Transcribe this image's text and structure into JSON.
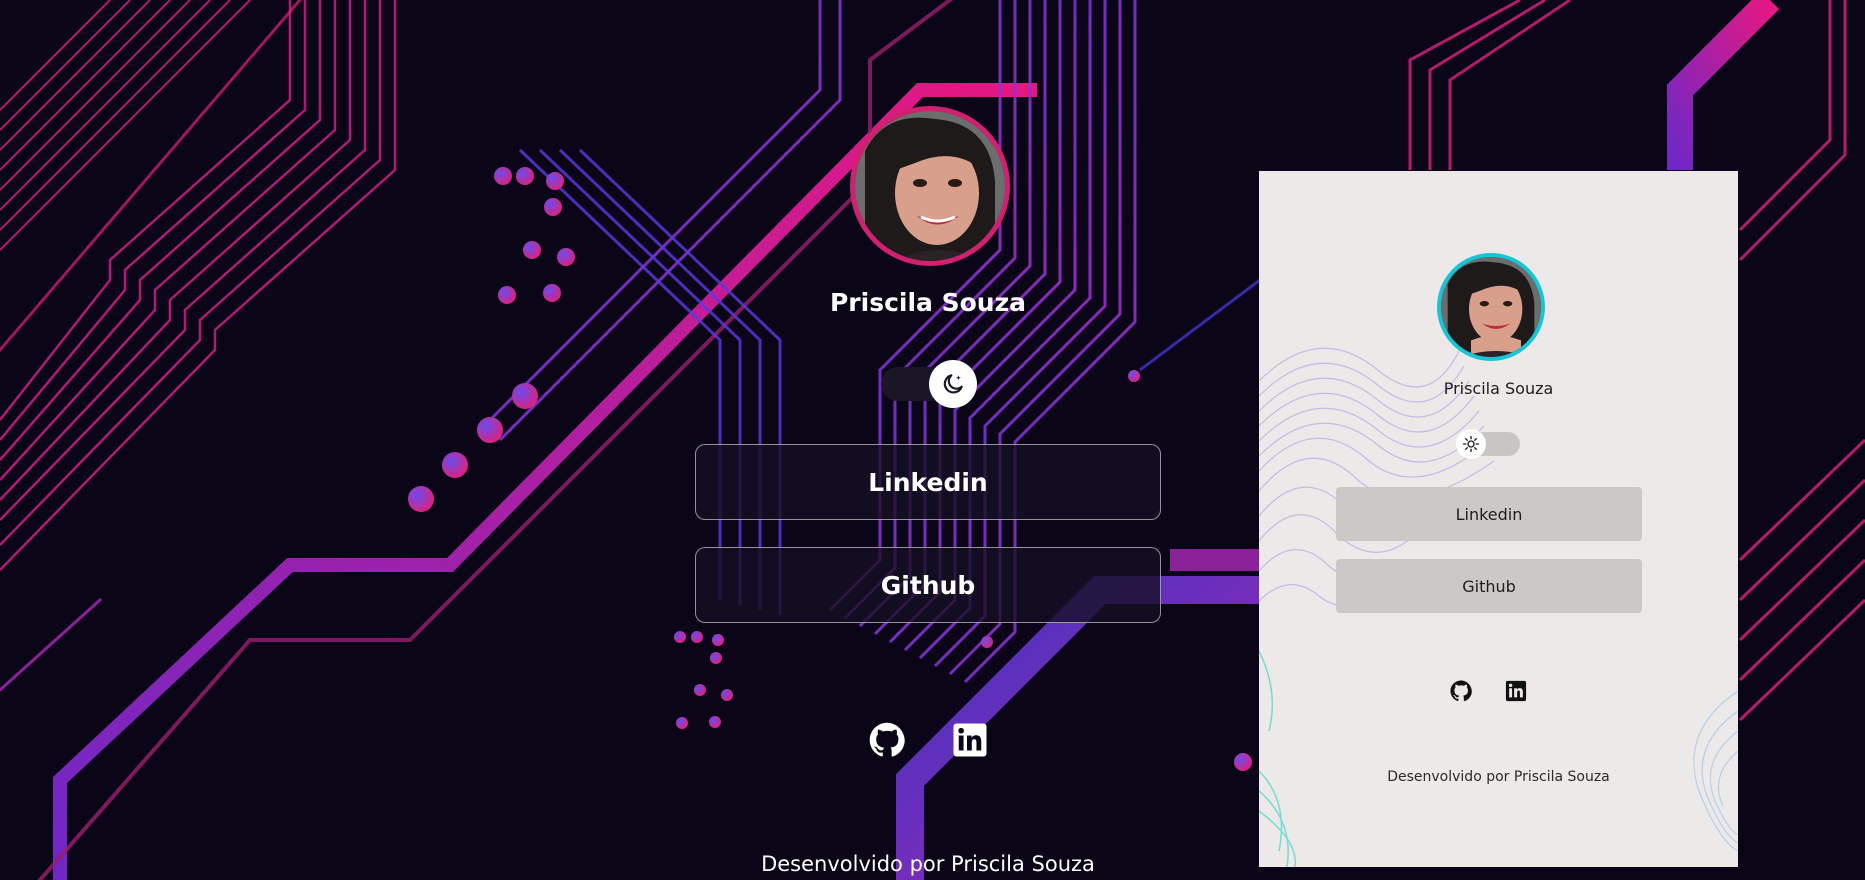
{
  "dark": {
    "name": "Priscila Souza",
    "theme_toggle_icon": "moon-icon",
    "buttons": [
      {
        "label": "Linkedin"
      },
      {
        "label": "Github"
      }
    ],
    "social_icons": [
      "github-icon",
      "linkedin-icon"
    ],
    "footer": "Desenvolvido por Priscila Souza"
  },
  "light": {
    "name": "Priscila Souza",
    "theme_toggle_icon": "sun-icon",
    "buttons": [
      {
        "label": "Linkedin"
      },
      {
        "label": "Github"
      }
    ],
    "social_icons": [
      "github-icon",
      "linkedin-icon"
    ],
    "footer": "Desenvolvido por Priscila Souza"
  },
  "colors": {
    "background": "#0a0618",
    "accent_pink": "#d0206f",
    "accent_purple": "#7b2bd9",
    "accent_cyan": "#17c6d6",
    "card_background": "#ece9e8"
  }
}
